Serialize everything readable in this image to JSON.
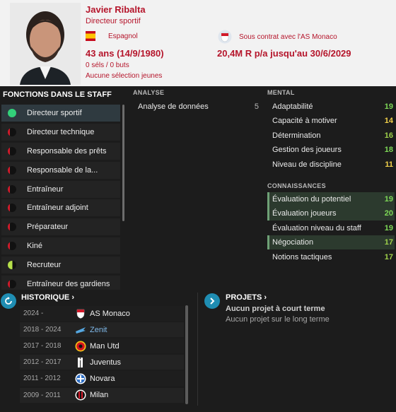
{
  "profile": {
    "name": "Javier Ribalta",
    "role": "Directeur sportif",
    "nationality": "Espagnol",
    "age_line": "43 ans (14/9/1980)",
    "stats_line": "0 séls / 0 buts",
    "youth_line": "Aucune sélection jeunes",
    "contract": "Sous contrat avec l'AS Monaco",
    "wage": "20,4M R p/a jusqu'au 30/6/2029"
  },
  "staff": {
    "title": "FONCTIONS DANS LE STAFF",
    "items": [
      {
        "label": "Directeur sportif",
        "fill": "full",
        "active": true
      },
      {
        "label": "Directeur technique",
        "fill": "low",
        "active": false
      },
      {
        "label": "Responsable des prêts",
        "fill": "low",
        "active": false
      },
      {
        "label": "Responsable de la...",
        "fill": "low",
        "active": false
      },
      {
        "label": "Entraîneur",
        "fill": "low",
        "active": false
      },
      {
        "label": "Entraîneur adjoint",
        "fill": "low",
        "active": false
      },
      {
        "label": "Préparateur",
        "fill": "low",
        "active": false
      },
      {
        "label": "Kiné",
        "fill": "low",
        "active": false
      },
      {
        "label": "Recruteur",
        "fill": "half",
        "active": false
      },
      {
        "label": "Entraîneur des gardiens",
        "fill": "low",
        "active": false
      }
    ]
  },
  "analyse": {
    "title": "ANALYSE",
    "items": [
      {
        "label": "Analyse de données",
        "value": "5"
      }
    ]
  },
  "mental": {
    "title": "MENTAL",
    "items": [
      {
        "label": "Adaptabilité",
        "value": "19",
        "color": "#7ed957",
        "hl": false
      },
      {
        "label": "Capacité à motiver",
        "value": "14",
        "color": "#f2d14a",
        "hl": false
      },
      {
        "label": "Détermination",
        "value": "16",
        "color": "#9fd14a",
        "hl": false
      },
      {
        "label": "Gestion des joueurs",
        "value": "18",
        "color": "#7ed957",
        "hl": false
      },
      {
        "label": "Niveau de discipline",
        "value": "11",
        "color": "#f2d14a",
        "hl": false
      }
    ]
  },
  "connaissances": {
    "title": "CONNAISSANCES",
    "items": [
      {
        "label": "Évaluation du potentiel",
        "value": "19",
        "color": "#7ed957",
        "hl": true
      },
      {
        "label": "Évaluation joueurs",
        "value": "20",
        "color": "#7ed957",
        "hl": true
      },
      {
        "label": "Évaluation niveau du staff",
        "value": "19",
        "color": "#7ed957",
        "hl": false
      },
      {
        "label": "Négociation",
        "value": "17",
        "color": "#9fd14a",
        "hl": true
      },
      {
        "label": "Notions tactiques",
        "value": "17",
        "color": "#9fd14a",
        "hl": false
      }
    ]
  },
  "history": {
    "title": "HISTORIQUE",
    "rows": [
      {
        "years": "2024 -",
        "club": "AS Monaco",
        "badge": "monaco-badge",
        "link": false
      },
      {
        "years": "2018 - 2024",
        "club": "Zenit",
        "badge": "zenit-badge",
        "link": true
      },
      {
        "years": "2017 - 2018",
        "club": "Man Utd",
        "badge": "manutd-badge",
        "link": false
      },
      {
        "years": "2012 - 2017",
        "club": "Juventus",
        "badge": "juventus-badge",
        "link": false
      },
      {
        "years": "2011 - 2012",
        "club": "Novara",
        "badge": "novara-badge",
        "link": false
      },
      {
        "years": "2009 - 2011",
        "club": "Milan",
        "badge": "milan-badge",
        "link": false
      }
    ]
  },
  "projects": {
    "title": "PROJETS",
    "short_term": "Aucun projet à court terme",
    "long_term": "Aucun projet sur le long terme"
  },
  "colors": {
    "brand_red": "#b5152b",
    "accent_blue": "#1f8db2",
    "dot_green": "#33d17a",
    "dot_lime": "#b6e04a",
    "dot_red": "#d11a2a"
  }
}
